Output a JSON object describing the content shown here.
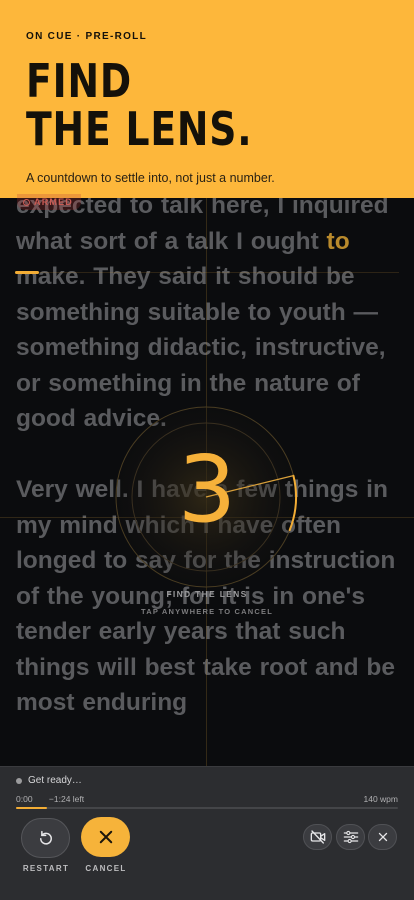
{
  "header": {
    "eyebrow": "ON CUE · PRE-ROLL",
    "title_line1": "FIND",
    "title_line2": "THE LENS.",
    "subtitle": "A countdown to settle into, not just a number."
  },
  "badge": {
    "label": "ARMED",
    "color": "#c95b55"
  },
  "script": {
    "line0": "expected to talk here, I",
    "p1_before_cursor": "inquired what sort of a talk I ought ",
    "p1_highlight": "to",
    "p1_after": " make. They said it should be something suitable to youth — something didactic, instructive, or something in the nature of good advice.",
    "p2": "Very well. I have a few things in my mind which I have often longed to say for the instruction of the young; for it is in one's tender early years that such things will best take root and be most enduring"
  },
  "countdown": {
    "number": "3",
    "progress": 0.28,
    "label": "FIND THE LENS",
    "hint": "TAP ANYWHERE TO CANCEL"
  },
  "player": {
    "status": "Get ready…",
    "elapsed": "0:00",
    "remaining": "−1:24 left",
    "wpm": "140 wpm",
    "progress": 0.08,
    "restart_label": "RESTART",
    "cancel_label": "CANCEL"
  },
  "colors": {
    "accent": "#f6b33a",
    "header_bg": "#fdb73b",
    "background": "#0b0c0e",
    "panel": "#2c2d30"
  },
  "icons": [
    "restart-icon",
    "close-icon",
    "camera-off-icon",
    "sliders-icon",
    "close-icon"
  ]
}
